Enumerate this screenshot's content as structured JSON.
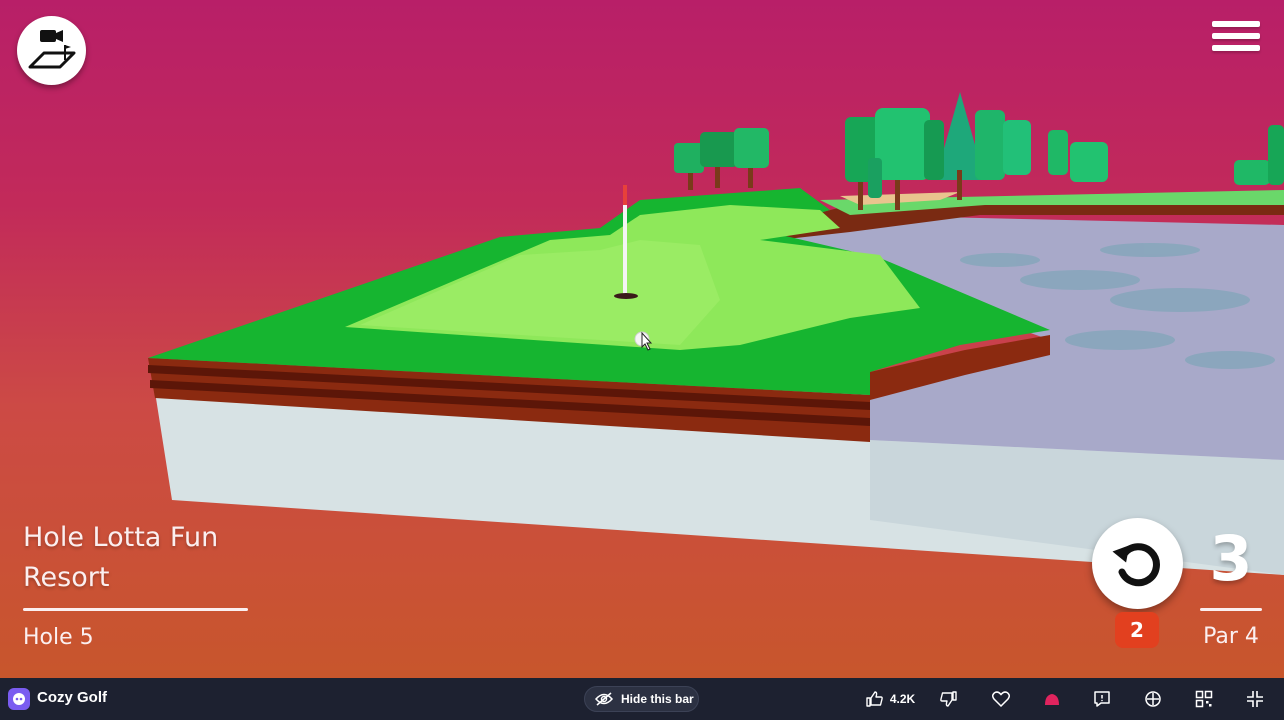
{
  "game": {
    "course_name": "Hole Lotta Fun Resort",
    "hole": "Hole 5",
    "strokes": "3",
    "par": "Par 4",
    "shots_badge": "2"
  },
  "icons": {
    "camera": "camera-view-icon",
    "menu": "hamburger-menu-icon",
    "reset": "reset-arrow-icon"
  },
  "bar": {
    "app_name": "Cozy Golf",
    "hide_label": "Hide this bar",
    "like_count": "4.2K"
  },
  "colors": {
    "sky_top": "#b81f68",
    "sky_bottom": "#c8562c",
    "grass": "#16b530",
    "green": "#8ee85a",
    "badge": "#e2401f",
    "bar_bg": "#1d2130"
  }
}
